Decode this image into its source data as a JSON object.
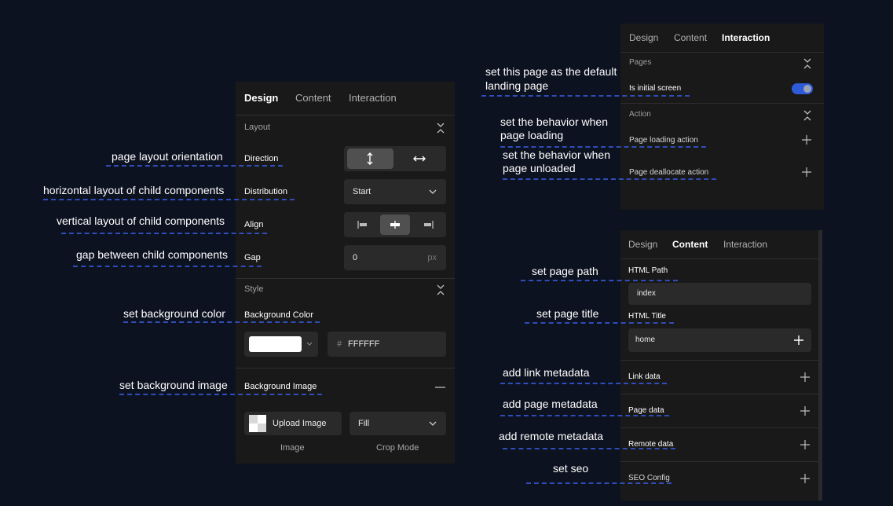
{
  "panel_left": {
    "tabs": [
      "Design",
      "Content",
      "Interaction"
    ],
    "layout_section": "Layout",
    "direction_label": "Direction",
    "distribution_label": "Distribution",
    "distribution_value": "Start",
    "align_label": "Align",
    "gap_label": "Gap",
    "gap_value": "0",
    "gap_unit": "px",
    "style_section": "Style",
    "bg_color_label": "Background Color",
    "bg_color_hash": "#",
    "bg_color_value": "FFFFFF",
    "bg_swatch_color": "#ffffff",
    "bg_image_label": "Background Image",
    "upload_label": "Upload Image",
    "crop_value": "Fill",
    "image_caption": "Image",
    "crop_caption": "Crop Mode"
  },
  "panel_interaction": {
    "tabs": [
      "Design",
      "Content",
      "Interaction"
    ],
    "pages_section": "Pages",
    "initial_screen_label": "Is initial screen",
    "initial_screen_on": true,
    "toggle_color": "#2f5bd8",
    "action_section": "Action",
    "load_action_label": "Page loading action",
    "dealloc_action_label": "Page deallocate action"
  },
  "panel_content": {
    "tabs": [
      "Design",
      "Content",
      "Interaction"
    ],
    "html_path_label": "HTML Path",
    "html_path_value": "index",
    "html_title_label": "HTML Title",
    "html_title_value": "home",
    "link_data_label": "Link data",
    "page_data_label": "Page data",
    "remote_data_label": "Remote data",
    "seo_label": "SEO Config"
  },
  "annotations": {
    "orientation": "page layout orientation",
    "horizontal": "horizontal layout of child components",
    "vertical": "vertical layout of child components",
    "gap": "gap between child components",
    "bg_color": "set background color",
    "bg_image": "set background image",
    "default_landing_1": "set this page as the default",
    "default_landing_2": "landing page",
    "behavior_load_1": "set the behavior when",
    "behavior_load_2": "page  loading",
    "behavior_unload_1": "set the behavior when",
    "behavior_unload_2": "page  unloaded",
    "page_path": "set  page path",
    "page_title": "set  page title",
    "link_meta": "add  link  metadata",
    "page_meta": "add  page metadata",
    "remote_meta": "add  remote metadata",
    "seo": "set  seo"
  }
}
